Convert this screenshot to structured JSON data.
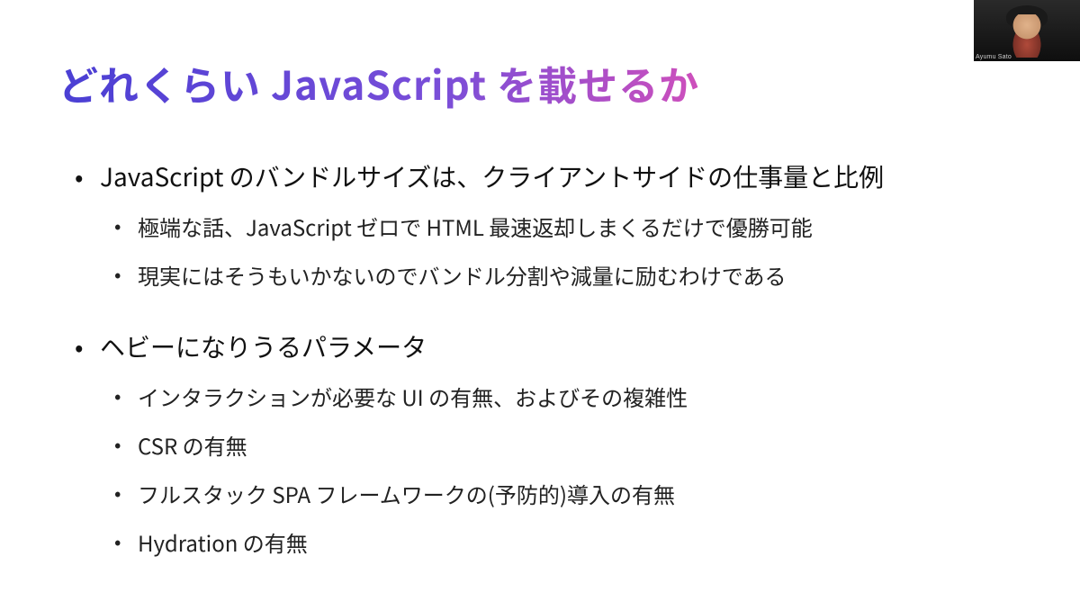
{
  "slide": {
    "title": "どれくらい JavaScript を載せるか",
    "bullets": [
      {
        "text": "JavaScript のバンドルサイズは、クライアントサイドの仕事量と比例",
        "children": [
          "極端な話、JavaScript ゼロで HTML 最速返却しまくるだけで優勝可能",
          "現実にはそうもいかないのでバンドル分割や減量に励むわけである"
        ]
      },
      {
        "text": "ヘビーになりうるパラメータ",
        "children": [
          "インタラクションが必要な UI の有無、およびその複雑性",
          "CSR の有無",
          "フルスタック SPA フレームワークの(予防的)導入の有無",
          "Hydration の有無"
        ]
      }
    ]
  },
  "webcam": {
    "name": "Ayumu Sato"
  }
}
